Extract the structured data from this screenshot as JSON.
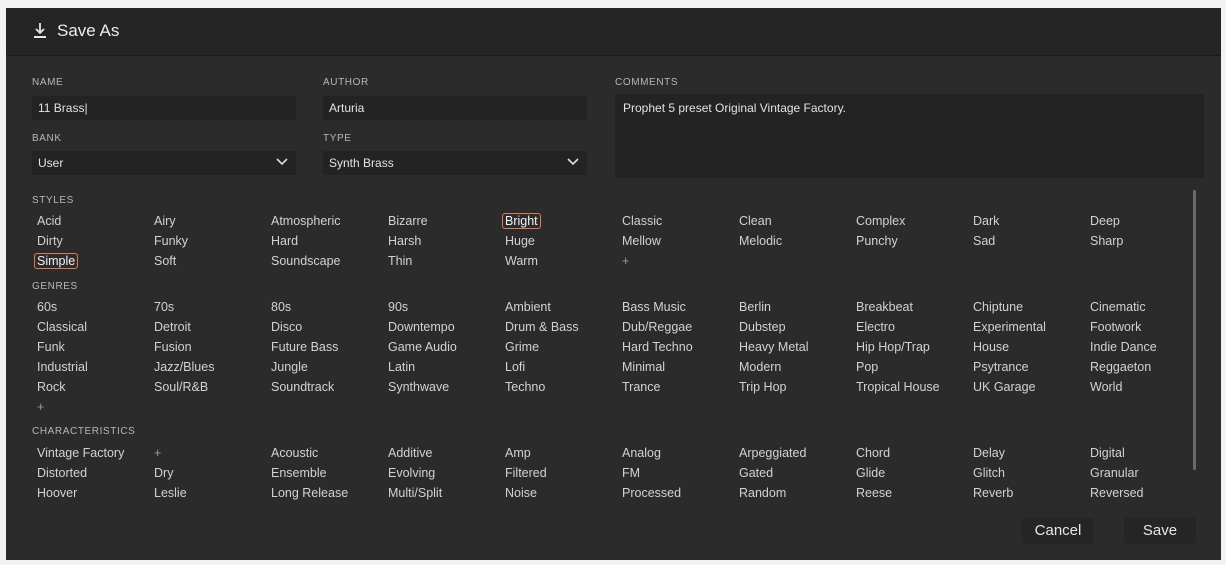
{
  "dialog": {
    "title": "Save As",
    "name_label": "NAME",
    "name_value": "11 Brass|",
    "author_label": "AUTHOR",
    "author_value": "Arturia",
    "comments_label": "COMMENTS",
    "comments_value": "Prophet 5 preset Original Vintage Factory.",
    "bank_label": "BANK",
    "bank_value": "User",
    "type_label": "TYPE",
    "type_value": "Synth Brass",
    "styles_label": "STYLES",
    "genres_label": "GENRES",
    "characteristics_label": "CHARACTERISTICS",
    "cancel_label": "Cancel",
    "save_label": "Save"
  },
  "styles": [
    "Acid",
    "Airy",
    "Atmospheric",
    "Bizarre",
    "Bright",
    "Classic",
    "Clean",
    "Complex",
    "Dark",
    "Deep",
    "Dirty",
    "Funky",
    "Hard",
    "Harsh",
    "Huge",
    "Mellow",
    "Melodic",
    "Punchy",
    "Sad",
    "Sharp",
    "Simple",
    "Soft",
    "Soundscape",
    "Thin",
    "Warm",
    "+"
  ],
  "styles_selected": [
    "Bright",
    "Simple"
  ],
  "genres": [
    "60s",
    "70s",
    "80s",
    "90s",
    "Ambient",
    "Bass Music",
    "Berlin",
    "Breakbeat",
    "Chiptune",
    "Cinematic",
    "Classical",
    "Detroit",
    "Disco",
    "Downtempo",
    "Drum & Bass",
    "Dub/Reggae",
    "Dubstep",
    "Electro",
    "Experimental",
    "Footwork",
    "Funk",
    "Fusion",
    "Future Bass",
    "Game Audio",
    "Grime",
    "Hard Techno",
    "Heavy Metal",
    "Hip Hop/Trap",
    "House",
    "Indie Dance",
    "Industrial",
    "Jazz/Blues",
    "Jungle",
    "Latin",
    "Lofi",
    "Minimal",
    "Modern",
    "Pop",
    "Psytrance",
    "Reggaeton",
    "Rock",
    "Soul/R&B",
    "Soundtrack",
    "Synthwave",
    "Techno",
    "Trance",
    "Trip Hop",
    "Tropical House",
    "UK Garage",
    "World",
    "+"
  ],
  "characteristics": [
    "Vintage Factory",
    "+",
    "Acoustic",
    "Additive",
    "Amp",
    "Analog",
    "Arpeggiated",
    "Chord",
    "Delay",
    "Digital",
    "Distorted",
    "Dry",
    "Ensemble",
    "Evolving",
    "Filtered",
    "FM",
    "Gated",
    "Glide",
    "Glitch",
    "Granular",
    "Hoover",
    "Leslie",
    "Long Release",
    "Multi/Split",
    "Noise",
    "Processed",
    "Random",
    "Reese",
    "Reverb",
    "Reversed"
  ],
  "colors": {
    "background": "#2b2b2c",
    "field": "#232324",
    "accent_selected": "#e07a4f",
    "text": "#d2d2d2"
  },
  "icons": {
    "title": "download-icon",
    "dropdown": "chevron-down-icon"
  }
}
